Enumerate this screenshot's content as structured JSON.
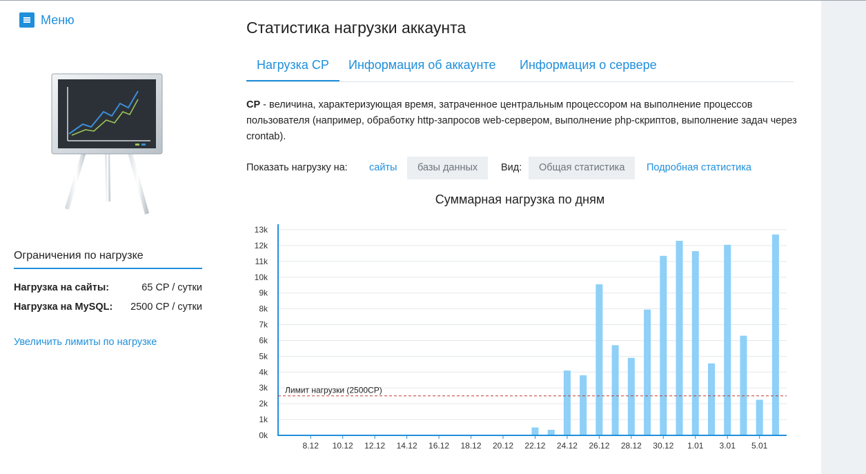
{
  "menu": {
    "label": "Меню",
    "icon": "hamburger-icon"
  },
  "sidebar": {
    "image": "presentation-easel-chart-icon",
    "limits_title": "Ограничения по нагрузке",
    "limits": [
      {
        "label": "Нагрузка на сайты:",
        "value": "65 CP / сутки"
      },
      {
        "label": "Нагрузка на MySQL:",
        "value": "2500 CP / сутки"
      }
    ],
    "increase_link": "Увеличить лимиты по нагрузке"
  },
  "page": {
    "title": "Статистика нагрузки аккаунта",
    "tabs": [
      {
        "label": "Нагрузка CP",
        "active": true
      },
      {
        "label": "Информация об аккаунте",
        "active": false
      },
      {
        "label": "Информация о сервере",
        "active": false
      }
    ],
    "description_term": "CP",
    "description": " - величина, характеризующая время, затраченное центральным процессором на выполнение процессов пользователя (например, обработку http-запросов web-сервером, выполнение php-скриптов, выполнение задач через crontab)."
  },
  "filters": {
    "show_label": "Показать нагрузку на:",
    "show_options": [
      {
        "label": "сайты",
        "selected": false
      },
      {
        "label": "базы данных",
        "selected": true
      }
    ],
    "view_label": "Вид:",
    "view_options": [
      {
        "label": "Общая статистика",
        "selected": true
      },
      {
        "label": "Подробная статистика",
        "selected": false
      }
    ]
  },
  "colors": {
    "accent": "#1f8fdb",
    "bar": "#8ed0f7",
    "limit_line": "#c0392b"
  },
  "chart_data": {
    "type": "bar",
    "title": "Суммарная нагрузка по дням",
    "xlabel": "",
    "ylabel": "",
    "ylim": [
      0,
      13000
    ],
    "yticks": [
      "0k",
      "1k",
      "2k",
      "3k",
      "4k",
      "5k",
      "6k",
      "7k",
      "8k",
      "9k",
      "10k",
      "11k",
      "12k",
      "13k"
    ],
    "xtick_labels": [
      "8.12",
      "10.12",
      "12.12",
      "14.12",
      "16.12",
      "18.12",
      "20.12",
      "22.12",
      "24.12",
      "26.12",
      "28.12",
      "30.12",
      "1.01",
      "3.01",
      "5.01"
    ],
    "categories": [
      "7.12",
      "8.12",
      "9.12",
      "10.12",
      "11.12",
      "12.12",
      "13.12",
      "14.12",
      "15.12",
      "16.12",
      "17.12",
      "18.12",
      "19.12",
      "20.12",
      "21.12",
      "22.12",
      "23.12",
      "24.12",
      "25.12",
      "26.12",
      "27.12",
      "28.12",
      "29.12",
      "30.12",
      "31.12",
      "1.01",
      "2.01",
      "3.01",
      "4.01",
      "5.01",
      "6.01"
    ],
    "values": [
      0,
      0,
      0,
      0,
      0,
      0,
      0,
      0,
      0,
      0,
      0,
      0,
      0,
      0,
      0,
      500,
      350,
      4100,
      3800,
      9550,
      5700,
      4900,
      7950,
      11350,
      12300,
      11650,
      4550,
      12050,
      6300,
      2250,
      12700
    ],
    "limit": {
      "label": "Лимит нагрузки (2500CP)",
      "value": 2500
    },
    "grid": true,
    "legend": "none"
  }
}
